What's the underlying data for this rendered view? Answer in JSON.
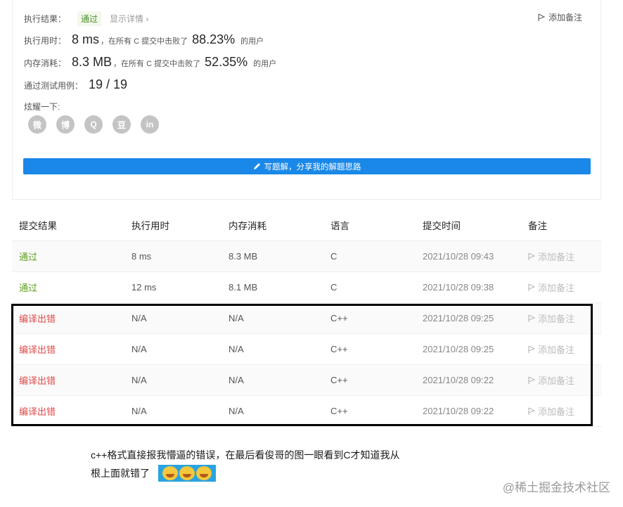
{
  "summary": {
    "result_label": "执行结果：",
    "result_value": "通过",
    "detail_link": "显示详情 ›",
    "add_note": "添加备注",
    "runtime_label": "执行用时：",
    "runtime_value": "8 ms",
    "runtime_mid": "，在所有 C 提交中击败了",
    "runtime_pct": "88.23%",
    "runtime_tail": "的用户",
    "memory_label": "内存消耗：",
    "memory_value": "8.3 MB",
    "memory_mid": "，在所有 C 提交中击败了",
    "memory_pct": "52.35%",
    "memory_tail": "的用户",
    "tests_label": "通过测试用例：",
    "tests_value": "19 / 19",
    "share_label": "炫耀一下:",
    "social_icons": [
      "wechat-icon",
      "weibo-icon",
      "qq-icon",
      "douban-icon",
      "linkedin-icon"
    ],
    "social_glyphs": [
      "微",
      "博",
      "Q",
      "豆",
      "in"
    ],
    "write_button": "写题解，分享我的解题思路"
  },
  "table": {
    "headers": [
      "提交结果",
      "执行用时",
      "内存消耗",
      "语言",
      "提交时间",
      "备注"
    ],
    "rows": [
      {
        "result": "通过",
        "status": "ok",
        "time": "8 ms",
        "memory": "8.3 MB",
        "lang": "C",
        "submitted": "2021/10/28 09:43",
        "note": "添加备注"
      },
      {
        "result": "通过",
        "status": "ok",
        "time": "12 ms",
        "memory": "8.1 MB",
        "lang": "C",
        "submitted": "2021/10/28 09:38",
        "note": "添加备注"
      },
      {
        "result": "编译出错",
        "status": "err",
        "time": "N/A",
        "memory": "N/A",
        "lang": "C++",
        "submitted": "2021/10/28 09:25",
        "note": "添加备注"
      },
      {
        "result": "编译出错",
        "status": "err",
        "time": "N/A",
        "memory": "N/A",
        "lang": "C++",
        "submitted": "2021/10/28 09:25",
        "note": "添加备注"
      },
      {
        "result": "编译出错",
        "status": "err",
        "time": "N/A",
        "memory": "N/A",
        "lang": "C++",
        "submitted": "2021/10/28 09:22",
        "note": "添加备注"
      },
      {
        "result": "编译出错",
        "status": "err",
        "time": "N/A",
        "memory": "N/A",
        "lang": "C++",
        "submitted": "2021/10/28 09:22",
        "note": "添加备注"
      }
    ]
  },
  "caption": {
    "line1": "c++格式直接报我懵逼的错误，在最后看俊哥的图一眼看到C才知道我从",
    "line2": "根上面就错了"
  },
  "watermark": "@稀土掘金技术社区",
  "colors": {
    "accent": "#1a88e8",
    "pass": "#5ba319",
    "error": "#e24a4a"
  }
}
